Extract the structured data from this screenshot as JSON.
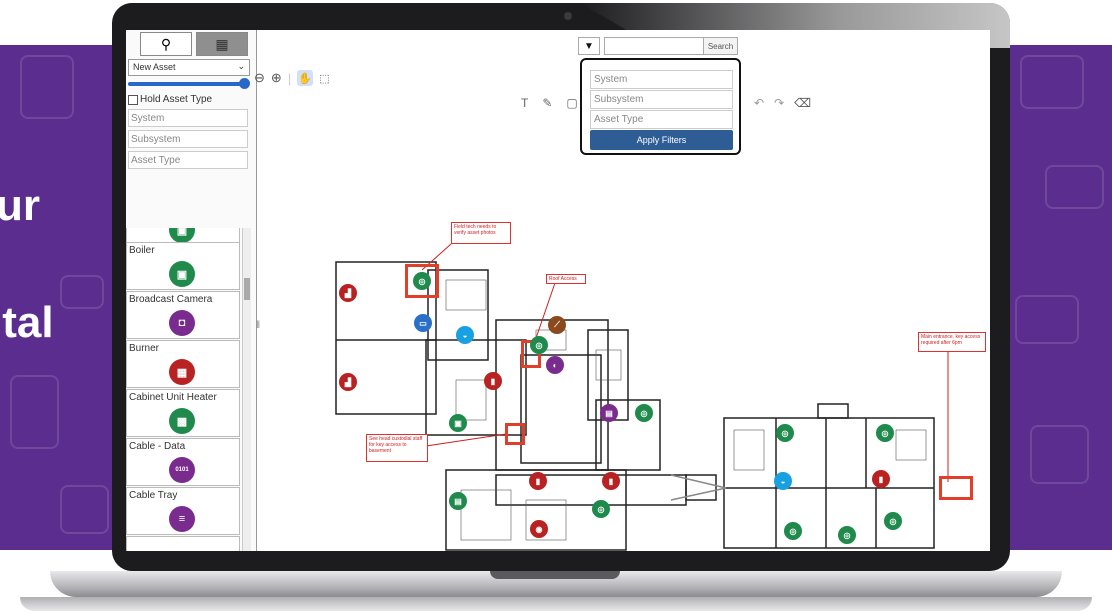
{
  "headline": {
    "line1": "ur",
    "line2": "ital"
  },
  "tabs": {
    "asset_tab_icon": "stamp-icon",
    "map_tab_icon": "building-icon"
  },
  "panel": {
    "asset_select": "New Asset",
    "hold_label": "Hold Asset Type",
    "placeholders": {
      "system": "System",
      "subsystem": "Subsystem",
      "asset_type": "Asset Type"
    },
    "assets": [
      {
        "label": "Boiler",
        "icon": "boiler-icon",
        "color": "#1f8a4c",
        "glyph": "▣"
      },
      {
        "label": "Broadcast Camera",
        "icon": "camera-icon",
        "color": "#7a2c8e",
        "glyph": "◘"
      },
      {
        "label": "Burner",
        "icon": "burner-icon",
        "color": "#b82222",
        "glyph": "▦"
      },
      {
        "label": "Cabinet Unit Heater",
        "icon": "heater-icon",
        "color": "#1f8a4c",
        "glyph": "▩"
      },
      {
        "label": "Cable - Data",
        "icon": "binary-icon",
        "color": "#7a2c8e",
        "glyph": "0101"
      },
      {
        "label": "Cable Tray",
        "icon": "tray-icon",
        "color": "#7a2c8e",
        "glyph": "≡"
      }
    ]
  },
  "search": {
    "button": "Search",
    "value": ""
  },
  "filters": {
    "system_placeholder": "System",
    "subsystem_placeholder": "Subsystem",
    "asset_type_placeholder": "Asset Type",
    "apply_label": "Apply Filters"
  },
  "notes": {
    "field_tech": "Field tech needs to verify asset photos",
    "roof": "Roof Access",
    "main_entrance": "Main entrance, key access required after 6pm",
    "custodial": "See head custodial staff for key access to basement"
  },
  "colors": {
    "brand_purple": "#5a2d8e",
    "apply_blue": "#2e5c94",
    "highlight_red": "#e0402a"
  }
}
